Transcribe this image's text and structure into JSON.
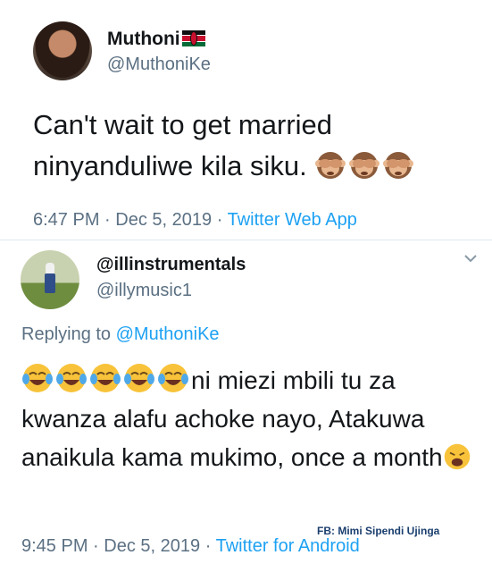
{
  "tweet1": {
    "name": "Muthoni",
    "handle": "@MuthoniKe",
    "text": "Can't wait to get married ninyanduliwe kila siku.",
    "emojis": [
      "see-no-evil-monkey-emoji",
      "see-no-evil-monkey-emoji",
      "see-no-evil-monkey-emoji"
    ],
    "time": "6:47 PM",
    "date": "Dec 5, 2019",
    "client": "Twitter Web App",
    "sep": "·"
  },
  "tweet2": {
    "name": "@illinstrumentals",
    "handle": "@illymusic1",
    "replying_prefix": "Replying to",
    "replying_to": "@MuthoniKe",
    "text_after_emojis": "ni miezi mbili tu za kwanza alafu achoke nayo, Atakuwa anaikula kama mukimo, once a month",
    "time": "9:45 PM",
    "date": "Dec 5, 2019",
    "client": "Twitter for Android",
    "sep": "·"
  },
  "watermark": "FB: Mimi Sipendi Ujinga",
  "colors": {
    "link": "#1da1f2",
    "secondary_text": "#5b7083",
    "primary_text": "#14171a"
  }
}
